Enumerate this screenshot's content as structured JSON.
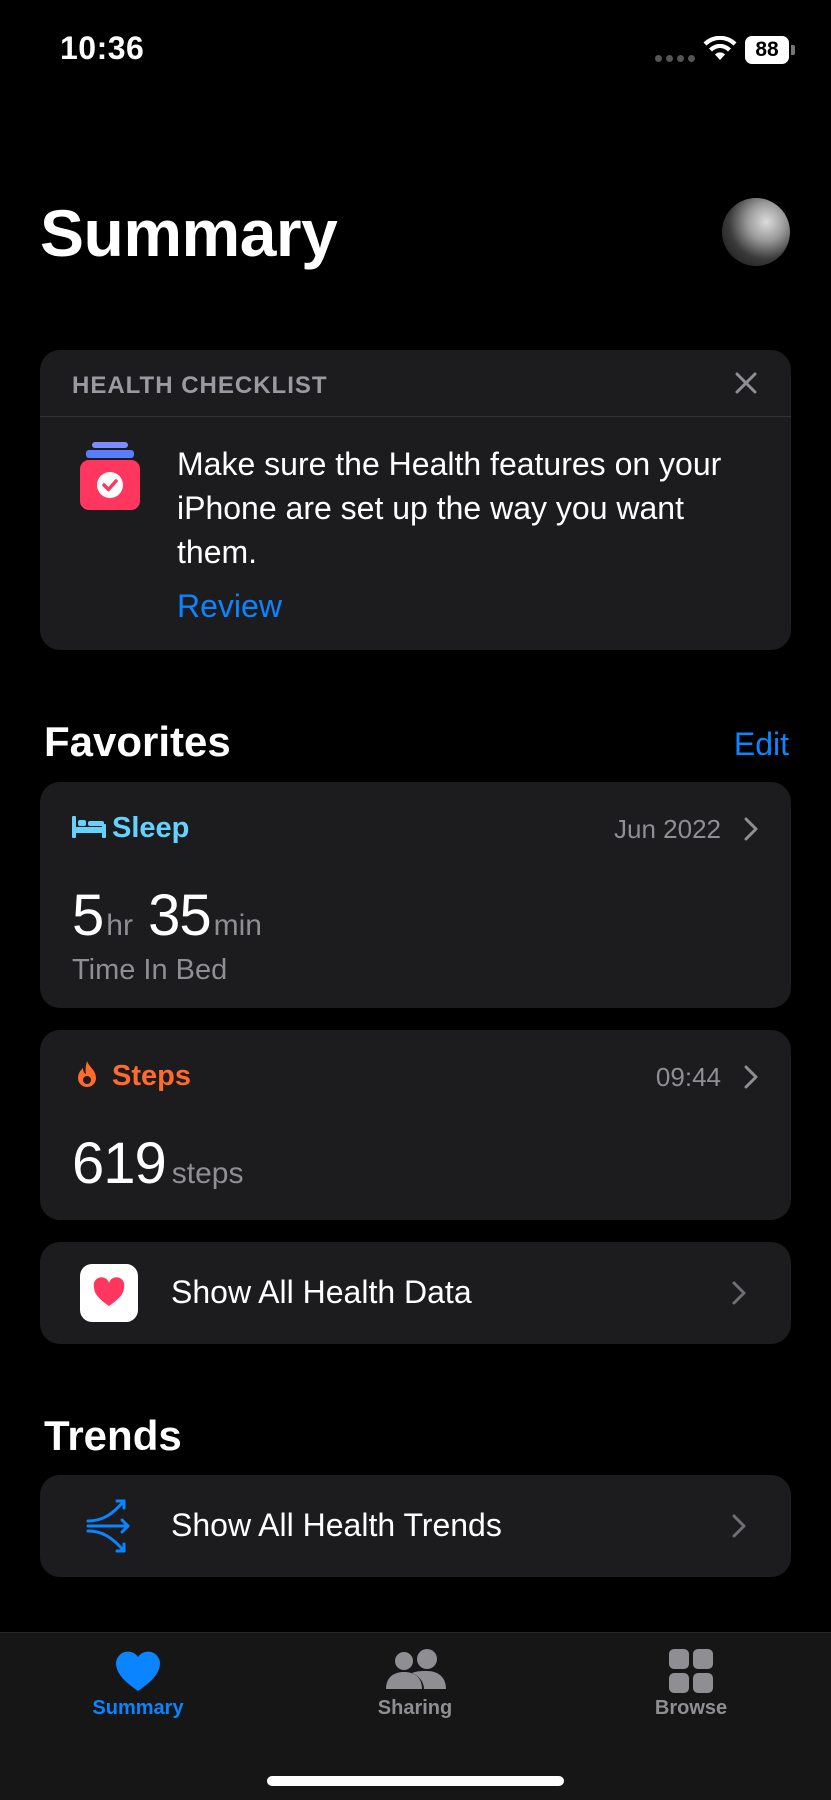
{
  "status_bar": {
    "time": "10:36",
    "battery": "88"
  },
  "header": {
    "title": "Summary"
  },
  "checklist": {
    "title": "HEALTH CHECKLIST",
    "message": "Make sure the Health features on your iPhone are set up the way you want them.",
    "action": "Review"
  },
  "favorites": {
    "title": "Favorites",
    "edit_label": "Edit",
    "sleep": {
      "label": "Sleep",
      "timestamp": "Jun 2022",
      "hours": "5",
      "hours_unit": "hr",
      "minutes": "35",
      "minutes_unit": "min",
      "caption": "Time In Bed",
      "color": "#64d2ff"
    },
    "steps": {
      "label": "Steps",
      "timestamp": "09:44",
      "value": "619",
      "unit": "steps",
      "color": "#ff6b2c"
    },
    "show_all": {
      "label": "Show All Health Data",
      "icon": "health-app-icon"
    }
  },
  "trends": {
    "title": "Trends",
    "show_all": {
      "label": "Show All Health Trends",
      "icon": "trends-icon"
    }
  },
  "tab_bar": {
    "items": [
      {
        "label": "Summary",
        "icon": "heart-icon",
        "active": true
      },
      {
        "label": "Sharing",
        "icon": "people-icon",
        "active": false
      },
      {
        "label": "Browse",
        "icon": "grid-icon",
        "active": false
      }
    ],
    "accent": "#0a84ff",
    "inactive": "#8e8e93"
  }
}
